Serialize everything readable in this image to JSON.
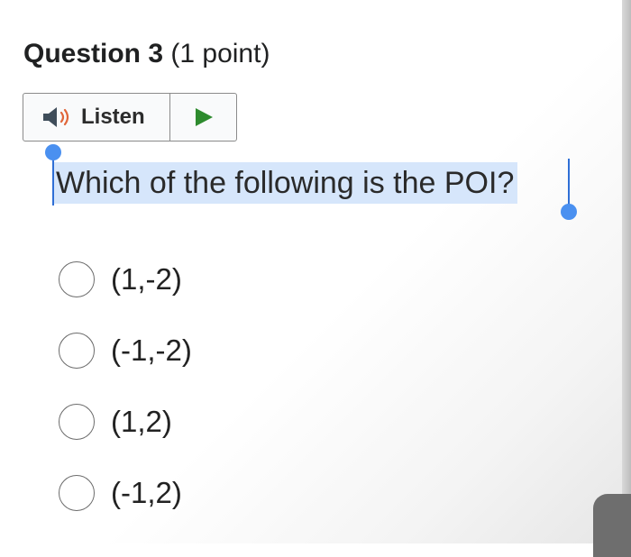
{
  "question": {
    "title": "Question 3",
    "points": "(1 point)",
    "text": "Which of the following is the POI?"
  },
  "listen": {
    "label": "Listen",
    "speaker_icon": "speaker-icon",
    "play_icon": "play-icon",
    "play_color": "#2e8b2e"
  },
  "options": [
    {
      "label": "(1,-2)",
      "selected": false
    },
    {
      "label": "(-1,-2)",
      "selected": false
    },
    {
      "label": "(1,2)",
      "selected": false
    },
    {
      "label": "(-1,2)",
      "selected": false
    }
  ],
  "colors": {
    "selection_highlight": "#d6e6fb",
    "selection_handle": "#4a90f0"
  }
}
